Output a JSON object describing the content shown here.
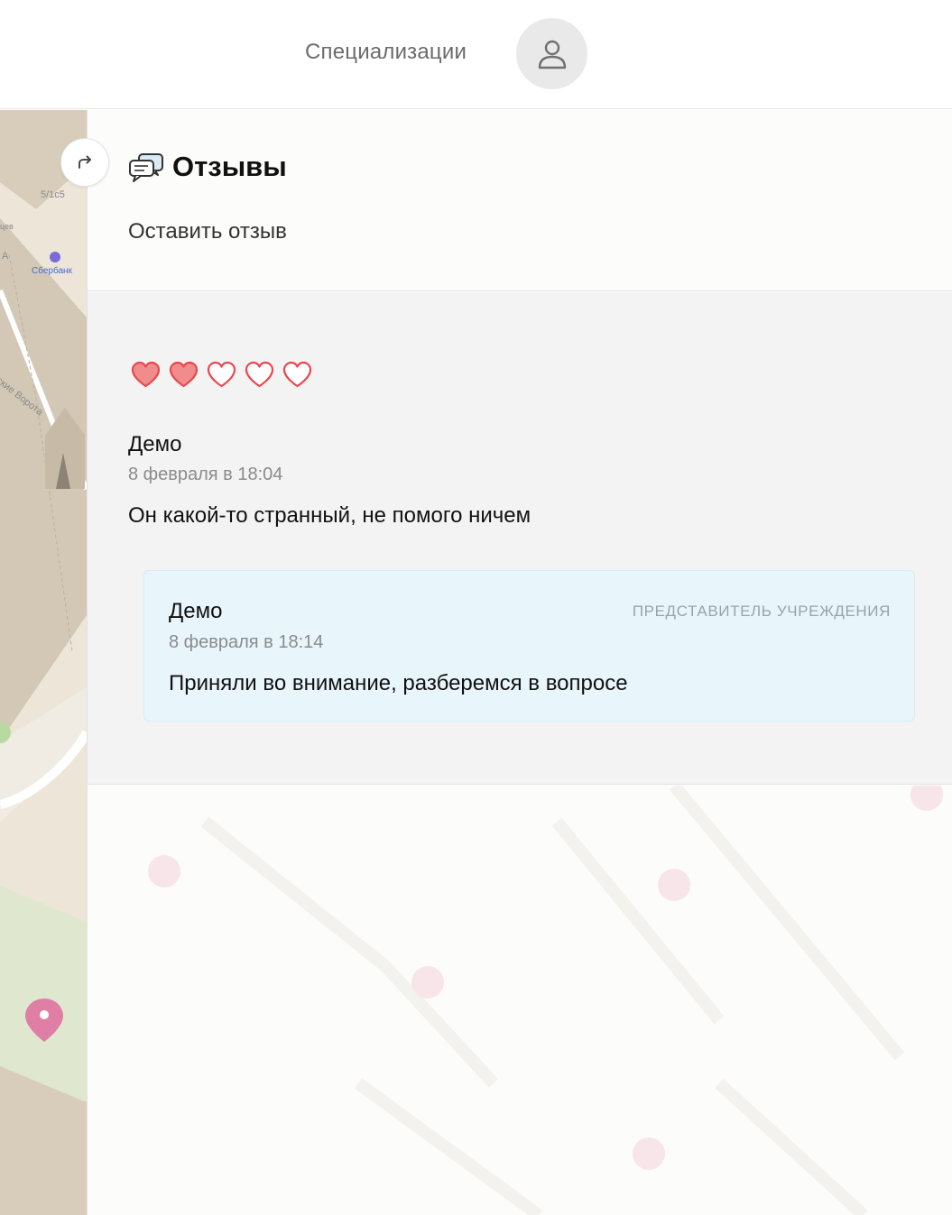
{
  "header": {
    "nav_link": "Специализации",
    "profile_icon": "user-icon"
  },
  "map": {
    "labels": {
      "house": "5/1с5",
      "street_partial_1": "цев",
      "street_partial_2": "А",
      "gate": "нские Ворота",
      "bank": "Сбербанк"
    },
    "collapse_icon": "share-arrow-icon",
    "pin_color": "#e07fa6"
  },
  "reviews_panel": {
    "title": "Отзывы",
    "title_icon": "chat-bubbles-icon",
    "leave_review_label": "Оставить отзыв"
  },
  "review": {
    "rating": 2,
    "max_rating": 5,
    "author": "Демо",
    "date": "8 февраля в 18:04",
    "text": "Он какой-то странный, не помого ничем",
    "reply": {
      "author": "Демо",
      "role": "ПРЕДСТАВИТЕЛЬ УЧРЕЖДЕНИЯ",
      "date": "8 февраля в 18:14",
      "text": "Приняли во внимание, разберемся в вопросе"
    }
  },
  "colors": {
    "heart_filled": "#f08c8c",
    "heart_stroke": "#e8474d",
    "reply_bg": "#e8f5fb",
    "reviews_bg": "#f3f3f3"
  }
}
